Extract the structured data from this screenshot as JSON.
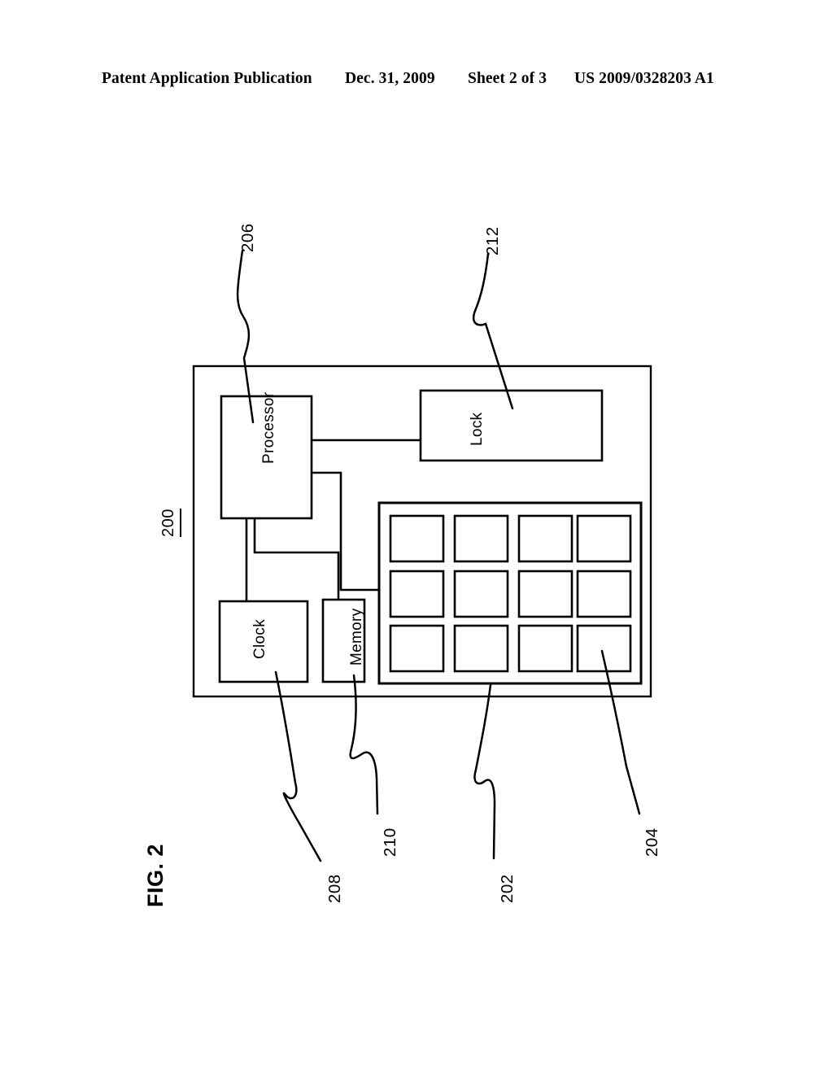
{
  "header": {
    "publication": "Patent Application Publication",
    "date": "Dec. 31, 2009",
    "sheet": "Sheet 2 of 3",
    "patent_number": "US 2009/0328203 A1"
  },
  "figure": {
    "caption": "FIG. 2",
    "assembly_ref": "200",
    "blocks": [
      {
        "id": "processor",
        "label": "Processor",
        "ref": "206"
      },
      {
        "id": "lock",
        "label": "Lock",
        "ref": "212"
      },
      {
        "id": "clock",
        "label": "Clock",
        "ref": "208"
      },
      {
        "id": "memory",
        "label": "Memory",
        "ref": "210"
      },
      {
        "id": "keypad",
        "label": "",
        "ref": "202"
      },
      {
        "id": "key",
        "label": "",
        "ref": "204"
      }
    ],
    "reference_numerals": {
      "assembly": "200",
      "keypad": "202",
      "key": "204",
      "processor": "206",
      "clock": "208",
      "memory": "210",
      "lock": "212"
    },
    "keypad": {
      "rows": 3,
      "columns": 4,
      "key_count": 12,
      "keys": [
        "",
        "",
        "",
        "",
        "",
        "",
        "",
        "",
        "",
        "",
        "",
        ""
      ]
    },
    "colors": {
      "line": "#000000",
      "background": "#ffffff"
    }
  }
}
